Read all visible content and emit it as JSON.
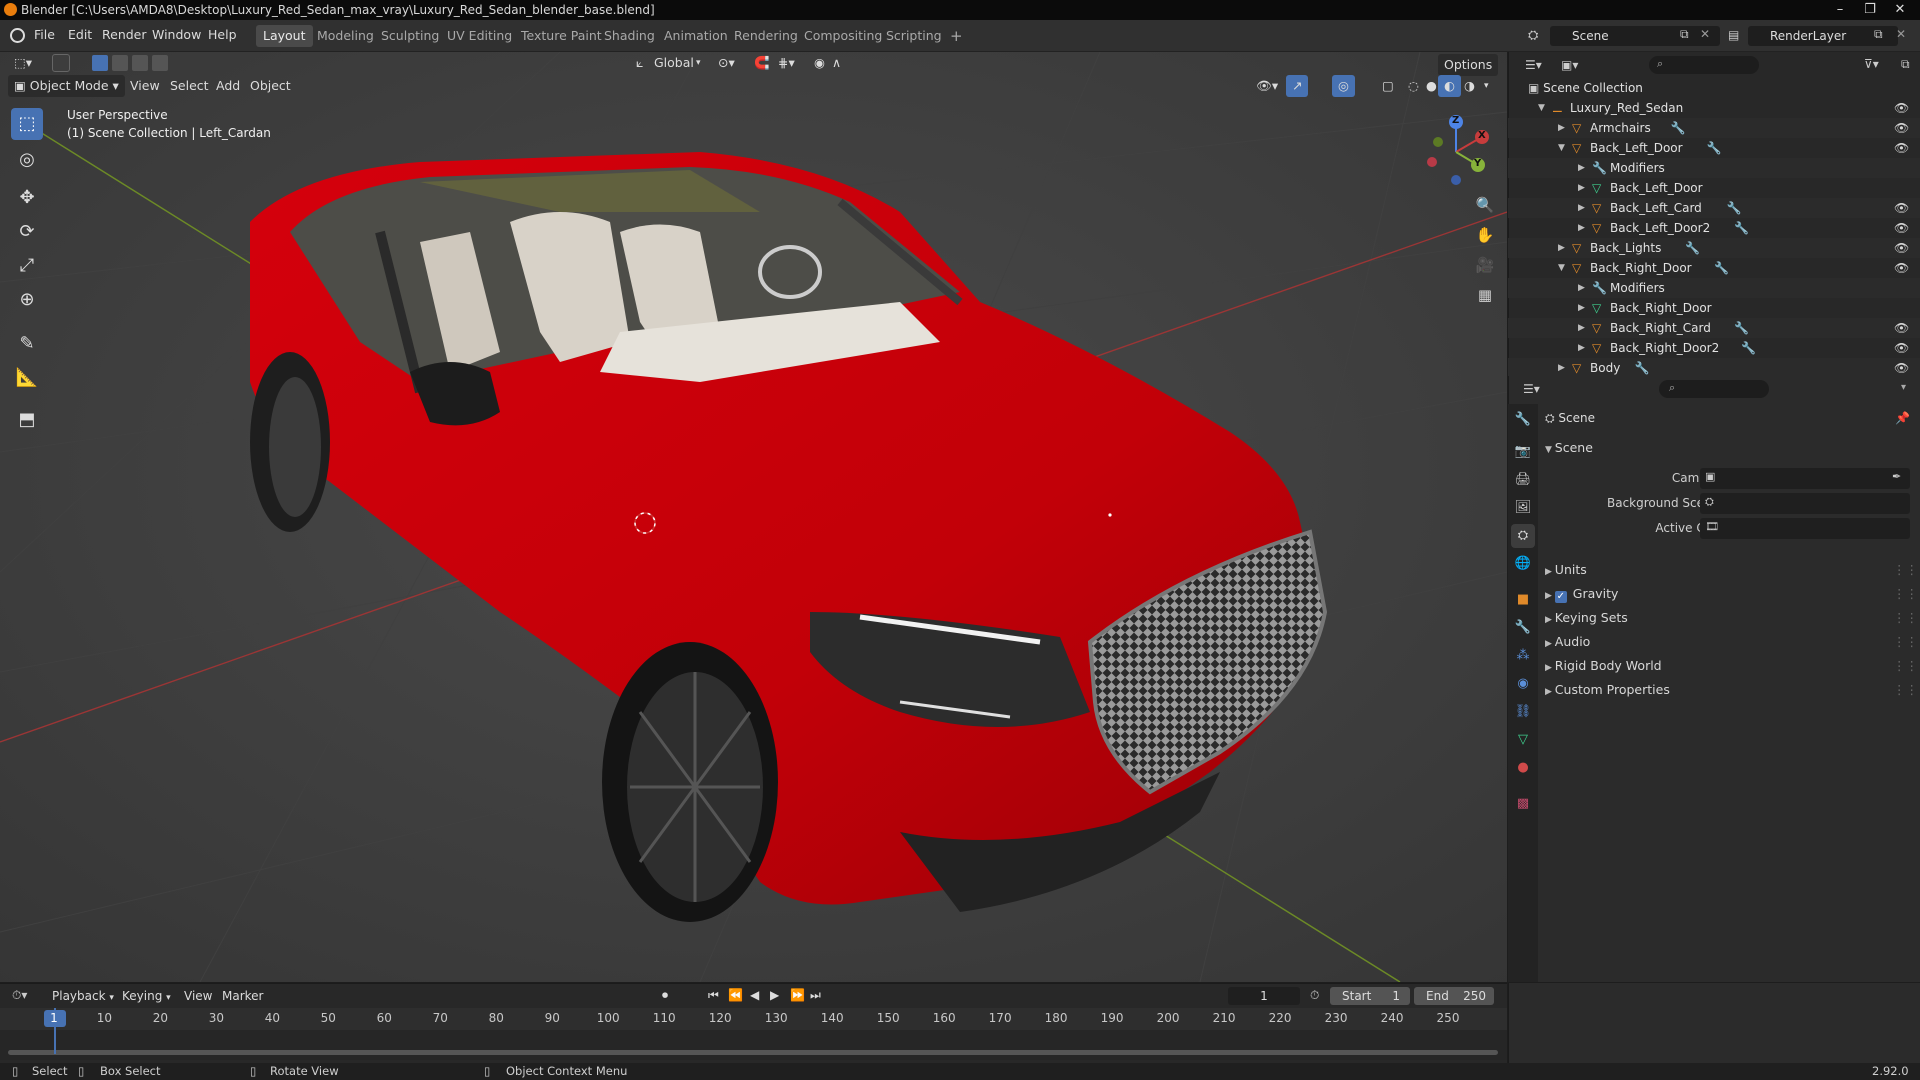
{
  "window": {
    "title": "Blender [C:\\Users\\AMDA8\\Desktop\\Luxury_Red_Sedan_max_vray\\Luxury_Red_Sedan_blender_base.blend]",
    "minimize": "–",
    "maximize": "❐",
    "close": "✕"
  },
  "menus": [
    "File",
    "Edit",
    "Render",
    "Window",
    "Help"
  ],
  "workspaces": [
    "Layout",
    "Modeling",
    "Sculpting",
    "UV Editing",
    "Texture Paint",
    "Shading",
    "Animation",
    "Rendering",
    "Compositing",
    "Scripting"
  ],
  "active_workspace": "Layout",
  "add_workspace": "+",
  "scene_field": "Scene",
  "renderlayer_field": "RenderLayer",
  "viewport": {
    "mode": "Object Mode",
    "menus": [
      "View",
      "Select",
      "Add",
      "Object"
    ],
    "orientation": "Global",
    "options": "Options",
    "overlay_line1": "User Perspective",
    "overlay_line2": "(1) Scene Collection | Left_Cardan",
    "gizmo": {
      "x": "X",
      "y": "Y",
      "z": "Z"
    }
  },
  "outliner": {
    "root": "Scene Collection",
    "rows": [
      {
        "label": "Luxury_Red_Sedan",
        "indent": 0,
        "expanded": true,
        "kind": "empty",
        "eye": true
      },
      {
        "label": "Armchairs",
        "indent": 1,
        "expanded": false,
        "kind": "object",
        "eye": true
      },
      {
        "label": "Back_Left_Door",
        "indent": 1,
        "expanded": true,
        "kind": "object",
        "eye": true
      },
      {
        "label": "Modifiers",
        "indent": 2,
        "expanded": false,
        "kind": "modifiers",
        "eye": false
      },
      {
        "label": "Back_Left_Door",
        "indent": 2,
        "expanded": false,
        "kind": "mesh",
        "eye": false
      },
      {
        "label": "Back_Left_Card",
        "indent": 2,
        "expanded": false,
        "kind": "object",
        "eye": true
      },
      {
        "label": "Back_Left_Door2",
        "indent": 2,
        "expanded": false,
        "kind": "object",
        "eye": true
      },
      {
        "label": "Back_Lights",
        "indent": 1,
        "expanded": false,
        "kind": "object",
        "eye": true
      },
      {
        "label": "Back_Right_Door",
        "indent": 1,
        "expanded": true,
        "kind": "object",
        "eye": true
      },
      {
        "label": "Modifiers",
        "indent": 2,
        "expanded": false,
        "kind": "modifiers",
        "eye": false
      },
      {
        "label": "Back_Right_Door",
        "indent": 2,
        "expanded": false,
        "kind": "mesh",
        "eye": false
      },
      {
        "label": "Back_Right_Card",
        "indent": 2,
        "expanded": false,
        "kind": "object",
        "eye": true
      },
      {
        "label": "Back_Right_Door2",
        "indent": 2,
        "expanded": false,
        "kind": "object",
        "eye": true
      },
      {
        "label": "Body",
        "indent": 1,
        "expanded": false,
        "kind": "object",
        "eye": true
      }
    ]
  },
  "properties": {
    "context": "Scene",
    "section": "Scene",
    "fields": {
      "camera": "Camera",
      "background_scene": "Background Scene",
      "active_clip": "Active Clip"
    },
    "panels": [
      "Units",
      "Gravity",
      "Keying Sets",
      "Audio",
      "Rigid Body World",
      "Custom Properties"
    ],
    "gravity_checked": true
  },
  "timeline": {
    "menus": [
      "Playback",
      "Keying",
      "View",
      "Marker"
    ],
    "current_frame": "1",
    "start_label": "Start",
    "start": "1",
    "end_label": "End",
    "end": "250",
    "ticks": [
      "1",
      "10",
      "20",
      "30",
      "40",
      "50",
      "60",
      "70",
      "80",
      "90",
      "100",
      "110",
      "120",
      "130",
      "140",
      "150",
      "160",
      "170",
      "180",
      "190",
      "200",
      "210",
      "220",
      "230",
      "240",
      "250"
    ]
  },
  "status": {
    "select": "Select",
    "box_select": "Box Select",
    "rotate_view": "Rotate View",
    "context_menu": "Object Context Menu",
    "version": "2.92.0"
  },
  "colors": {
    "accent": "#4772b3",
    "car_red": "#c20008",
    "orange": "#e08a2a",
    "mesh_green": "#3fcf8e",
    "axis_red": "#c23a3a",
    "axis_green": "#7a9a2a"
  }
}
